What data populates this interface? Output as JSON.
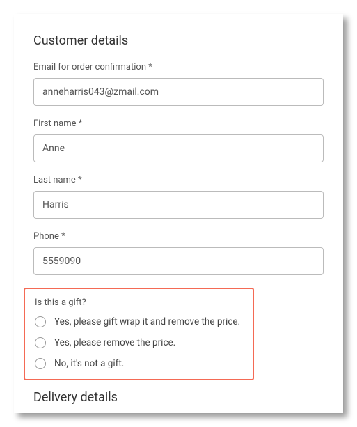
{
  "headings": {
    "customer": "Customer details",
    "delivery": "Delivery details"
  },
  "fields": {
    "email": {
      "label": "Email for order confirmation *",
      "value": "anneharris043@zmail.com"
    },
    "first_name": {
      "label": "First name *",
      "value": "Anne"
    },
    "last_name": {
      "label": "Last name *",
      "value": "Harris"
    },
    "phone": {
      "label": "Phone *",
      "value": "5559090"
    }
  },
  "gift": {
    "label": "Is this a gift?",
    "options": [
      "Yes, please gift wrap it and remove the price.",
      "Yes, please remove the price.",
      "No, it's not a gift."
    ]
  }
}
